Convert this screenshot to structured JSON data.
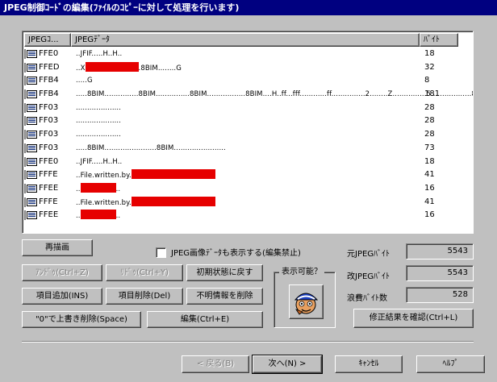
{
  "window": {
    "title": "JPEG制御ｺｰﾄﾞの編集(ﾌｧｲﾙのｺﾋﾟｰに対して処理を行います)"
  },
  "list": {
    "columns": [
      "JPEGｺ...",
      "JPEGﾃﾞｰﾀ",
      "ﾊﾞｲﾄ"
    ],
    "rows": [
      {
        "code": "FFE0",
        "data": "..JFIF.....H..H..",
        "redactions": [],
        "bytes": "18"
      },
      {
        "code": "FFED",
        "data": "..X",
        "redactions": [
          66
        ],
        "suffix": ".8BIM........G",
        "bytes": "32"
      },
      {
        "code": "FFB4",
        "data": ".....G",
        "redactions": [],
        "bytes": "8"
      },
      {
        "code": "FFB4",
        "data": ".....8BIM...............8BIM...............8BIM.................8BIM....H..ff...fff............ff...............2........Z...............5..................8BI..",
        "redactions": [],
        "bytes": "181"
      },
      {
        "code": "FF03",
        "data": "....................",
        "redactions": [],
        "bytes": "28"
      },
      {
        "code": "FF03",
        "data": "....................",
        "redactions": [],
        "bytes": "28"
      },
      {
        "code": "FF03",
        "data": "....................",
        "redactions": [],
        "bytes": "28"
      },
      {
        "code": "FF03",
        "data": ".....8BIM.......................8BIM.......................",
        "redactions": [],
        "bytes": "73"
      },
      {
        "code": "FFE0",
        "data": "..JFIF.....H..H..",
        "redactions": [],
        "bytes": "18"
      },
      {
        "code": "FFFE",
        "data": "..File.written.by.",
        "redactions": [
          104
        ],
        "suffix": "",
        "bytes": "41"
      },
      {
        "code": "FFEE",
        "data": "..",
        "redactions": [
          44
        ],
        "suffix": "..",
        "bytes": "16"
      },
      {
        "code": "FFFE",
        "data": "..File.written.by.",
        "redactions": [
          104
        ],
        "suffix": "",
        "bytes": "41"
      },
      {
        "code": "FFEE",
        "data": "..",
        "redactions": [
          44
        ],
        "suffix": "..",
        "bytes": "16"
      }
    ]
  },
  "buttons": {
    "redraw": "再描画",
    "undo": "ｱﾝﾄﾞｩ(Ctrl+Z)",
    "redo": "ﾘﾄﾞｩ(Ctrl+Y)",
    "reset": "初期状態に戻す",
    "add_item": "項目追加(INS)",
    "delete_item": "項目削除(Del)",
    "delete_unknown": "不明情報を削除",
    "overwrite_delete": "\"0\"で上書き削除(Space)",
    "edit": "編集(Ctrl+E)",
    "confirm": "修正結果を確認(Ctrl+L)",
    "back": "< 戻る(B)",
    "next": "次へ(N) >",
    "cancel": "ｷｬﾝｾﾙ",
    "help": "ﾍﾙﾌﾟ"
  },
  "checkbox": {
    "label": "JPEG画像ﾃﾞｰﾀも表示する(編集禁止)",
    "checked": false
  },
  "preview_group": {
    "label": "表示可能？"
  },
  "stats": {
    "original_label": "元JPEGﾊﾞｲﾄ",
    "original_value": "5543",
    "modified_label": "改JPEGﾊﾞｲﾄ",
    "modified_value": "5543",
    "waste_label": "浪費ﾊﾞｲﾄ数",
    "waste_value": "528"
  },
  "colors": {
    "title_bg": "#000080",
    "face": "#c0c0c0",
    "redaction": "#e60000"
  }
}
